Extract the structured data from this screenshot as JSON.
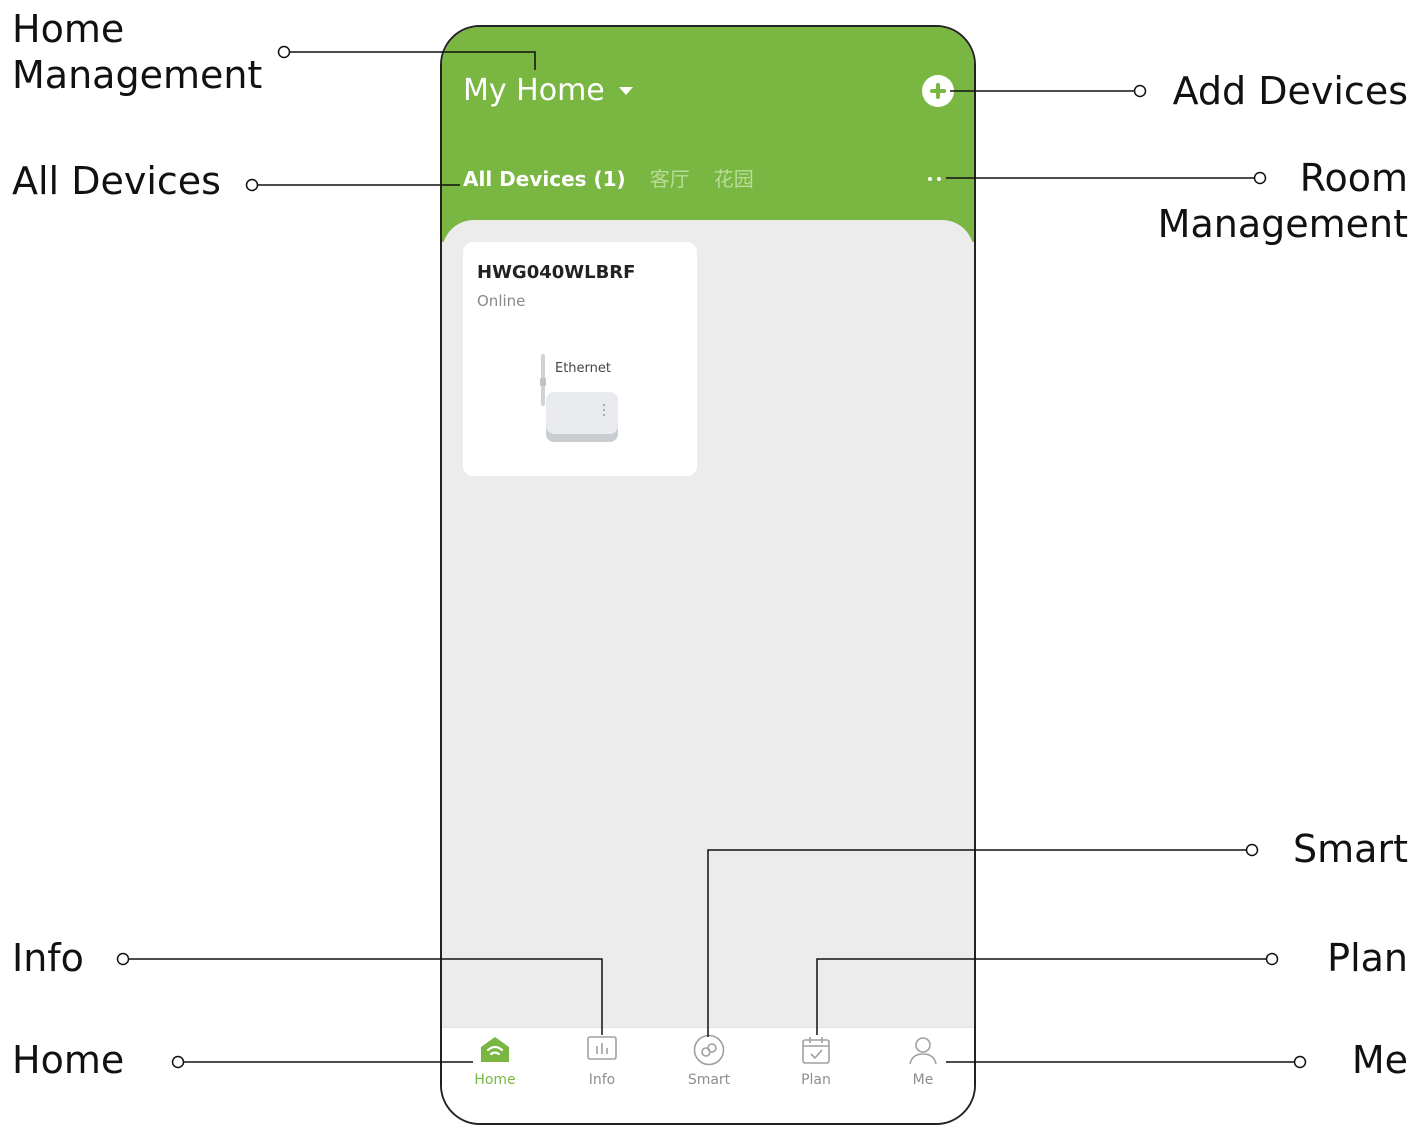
{
  "callouts": {
    "home_management": [
      "Home",
      "Management"
    ],
    "all_devices": "All Devices",
    "info": "Info",
    "home": "Home",
    "add_devices": "Add Devices",
    "room_management": [
      "Room",
      "Management"
    ],
    "smart": "Smart",
    "plan": "Plan",
    "me": "Me"
  },
  "app": {
    "home_title": "My Home",
    "tabs": [
      "All Devices (1)",
      "客厅",
      "花园"
    ],
    "device": {
      "name": "HWG040WLBRF",
      "status": "Online",
      "image_label": "Ethernet"
    },
    "nav": [
      "Home",
      "Info",
      "Smart",
      "Plan",
      "Me"
    ]
  },
  "colors": {
    "accent": "#79b642",
    "inactive_tab": "#b9dc99",
    "background": "#ececec"
  }
}
